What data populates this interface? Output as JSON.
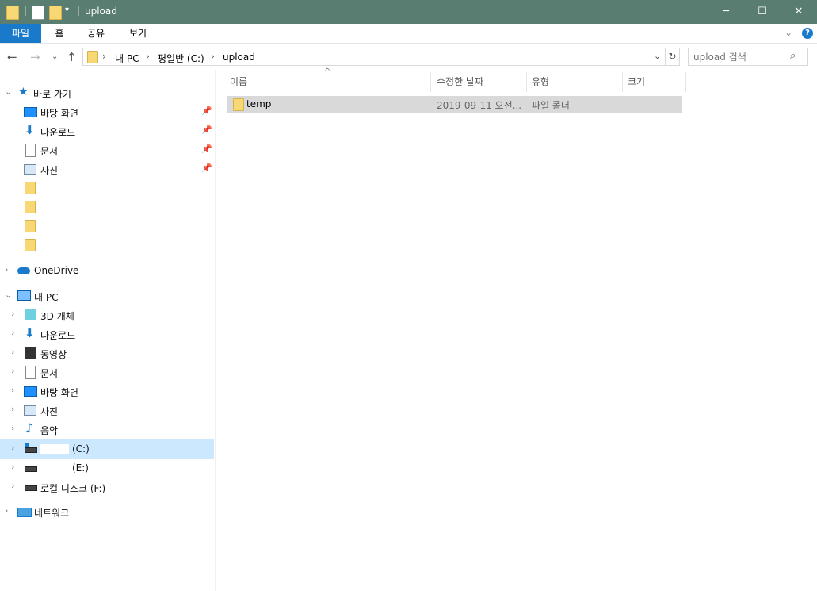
{
  "window": {
    "title": "upload",
    "minimize": "─",
    "maximize": "☐",
    "close": "✕"
  },
  "ribbon": {
    "tabs": [
      "파일",
      "홈",
      "공유",
      "보기"
    ],
    "expand_icon": "chevron-down-icon",
    "help_label": "?"
  },
  "address": {
    "segments": [
      "내 PC",
      "평일반 (C:)",
      "upload"
    ],
    "separator": "›"
  },
  "search": {
    "placeholder": "upload 검색"
  },
  "nav_pane": {
    "quick_access": {
      "label": "바로 가기",
      "items": [
        {
          "label": "바탕 화면",
          "icon": "desktop-icon",
          "pinned": true
        },
        {
          "label": "다운로드",
          "icon": "download-icon",
          "pinned": true
        },
        {
          "label": "문서",
          "icon": "document-icon",
          "pinned": true
        },
        {
          "label": "사진",
          "icon": "pictures-icon",
          "pinned": true
        },
        {
          "label": "",
          "icon": "folder-icon",
          "pinned": false
        },
        {
          "label": "",
          "icon": "folder-icon",
          "pinned": false
        },
        {
          "label": "",
          "icon": "folder-icon",
          "pinned": false
        },
        {
          "label": "",
          "icon": "folder-icon",
          "pinned": false
        }
      ]
    },
    "onedrive": {
      "label": "OneDrive"
    },
    "this_pc": {
      "label": "내 PC",
      "items": [
        {
          "label": "3D 개체",
          "icon": "3d-objects-icon"
        },
        {
          "label": "다운로드",
          "icon": "download-icon"
        },
        {
          "label": "동영상",
          "icon": "video-icon"
        },
        {
          "label": "문서",
          "icon": "document-icon"
        },
        {
          "label": "바탕 화면",
          "icon": "desktop-icon"
        },
        {
          "label": "사진",
          "icon": "pictures-icon"
        },
        {
          "label": "음악",
          "icon": "music-icon"
        },
        {
          "label": "(C:)",
          "icon": "drive-icon",
          "selected": true
        },
        {
          "label": "(E:)",
          "icon": "drive-icon"
        },
        {
          "label": "로컬 디스크 (F:)",
          "icon": "drive-icon"
        }
      ]
    },
    "network": {
      "label": "네트워크"
    }
  },
  "content": {
    "columns": [
      "이름",
      "수정한 날짜",
      "유형",
      "크기"
    ],
    "rows": [
      {
        "name": "temp",
        "modified": "2019-09-11 오전...",
        "type": "파일 폴더",
        "size": ""
      }
    ]
  },
  "colors": {
    "titlebar": "#5a7d72",
    "file_tab": "#1979ca",
    "selection": "#cce8ff",
    "row_selection": "#d9d9d9"
  }
}
